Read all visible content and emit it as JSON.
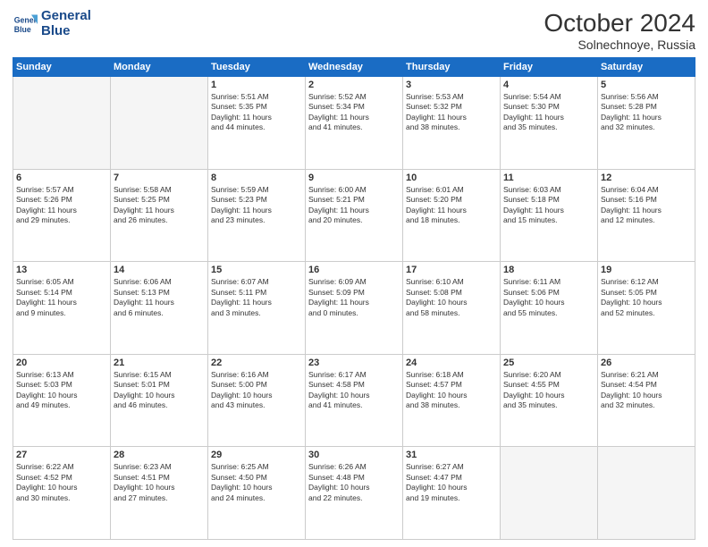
{
  "header": {
    "logo_line1": "General",
    "logo_line2": "Blue",
    "month_title": "October 2024",
    "subtitle": "Solnechnoye, Russia"
  },
  "weekdays": [
    "Sunday",
    "Monday",
    "Tuesday",
    "Wednesday",
    "Thursday",
    "Friday",
    "Saturday"
  ],
  "weeks": [
    [
      {
        "day": "",
        "text": ""
      },
      {
        "day": "",
        "text": ""
      },
      {
        "day": "1",
        "text": "Sunrise: 5:51 AM\nSunset: 5:35 PM\nDaylight: 11 hours\nand 44 minutes."
      },
      {
        "day": "2",
        "text": "Sunrise: 5:52 AM\nSunset: 5:34 PM\nDaylight: 11 hours\nand 41 minutes."
      },
      {
        "day": "3",
        "text": "Sunrise: 5:53 AM\nSunset: 5:32 PM\nDaylight: 11 hours\nand 38 minutes."
      },
      {
        "day": "4",
        "text": "Sunrise: 5:54 AM\nSunset: 5:30 PM\nDaylight: 11 hours\nand 35 minutes."
      },
      {
        "day": "5",
        "text": "Sunrise: 5:56 AM\nSunset: 5:28 PM\nDaylight: 11 hours\nand 32 minutes."
      }
    ],
    [
      {
        "day": "6",
        "text": "Sunrise: 5:57 AM\nSunset: 5:26 PM\nDaylight: 11 hours\nand 29 minutes."
      },
      {
        "day": "7",
        "text": "Sunrise: 5:58 AM\nSunset: 5:25 PM\nDaylight: 11 hours\nand 26 minutes."
      },
      {
        "day": "8",
        "text": "Sunrise: 5:59 AM\nSunset: 5:23 PM\nDaylight: 11 hours\nand 23 minutes."
      },
      {
        "day": "9",
        "text": "Sunrise: 6:00 AM\nSunset: 5:21 PM\nDaylight: 11 hours\nand 20 minutes."
      },
      {
        "day": "10",
        "text": "Sunrise: 6:01 AM\nSunset: 5:20 PM\nDaylight: 11 hours\nand 18 minutes."
      },
      {
        "day": "11",
        "text": "Sunrise: 6:03 AM\nSunset: 5:18 PM\nDaylight: 11 hours\nand 15 minutes."
      },
      {
        "day": "12",
        "text": "Sunrise: 6:04 AM\nSunset: 5:16 PM\nDaylight: 11 hours\nand 12 minutes."
      }
    ],
    [
      {
        "day": "13",
        "text": "Sunrise: 6:05 AM\nSunset: 5:14 PM\nDaylight: 11 hours\nand 9 minutes."
      },
      {
        "day": "14",
        "text": "Sunrise: 6:06 AM\nSunset: 5:13 PM\nDaylight: 11 hours\nand 6 minutes."
      },
      {
        "day": "15",
        "text": "Sunrise: 6:07 AM\nSunset: 5:11 PM\nDaylight: 11 hours\nand 3 minutes."
      },
      {
        "day": "16",
        "text": "Sunrise: 6:09 AM\nSunset: 5:09 PM\nDaylight: 11 hours\nand 0 minutes."
      },
      {
        "day": "17",
        "text": "Sunrise: 6:10 AM\nSunset: 5:08 PM\nDaylight: 10 hours\nand 58 minutes."
      },
      {
        "day": "18",
        "text": "Sunrise: 6:11 AM\nSunset: 5:06 PM\nDaylight: 10 hours\nand 55 minutes."
      },
      {
        "day": "19",
        "text": "Sunrise: 6:12 AM\nSunset: 5:05 PM\nDaylight: 10 hours\nand 52 minutes."
      }
    ],
    [
      {
        "day": "20",
        "text": "Sunrise: 6:13 AM\nSunset: 5:03 PM\nDaylight: 10 hours\nand 49 minutes."
      },
      {
        "day": "21",
        "text": "Sunrise: 6:15 AM\nSunset: 5:01 PM\nDaylight: 10 hours\nand 46 minutes."
      },
      {
        "day": "22",
        "text": "Sunrise: 6:16 AM\nSunset: 5:00 PM\nDaylight: 10 hours\nand 43 minutes."
      },
      {
        "day": "23",
        "text": "Sunrise: 6:17 AM\nSunset: 4:58 PM\nDaylight: 10 hours\nand 41 minutes."
      },
      {
        "day": "24",
        "text": "Sunrise: 6:18 AM\nSunset: 4:57 PM\nDaylight: 10 hours\nand 38 minutes."
      },
      {
        "day": "25",
        "text": "Sunrise: 6:20 AM\nSunset: 4:55 PM\nDaylight: 10 hours\nand 35 minutes."
      },
      {
        "day": "26",
        "text": "Sunrise: 6:21 AM\nSunset: 4:54 PM\nDaylight: 10 hours\nand 32 minutes."
      }
    ],
    [
      {
        "day": "27",
        "text": "Sunrise: 6:22 AM\nSunset: 4:52 PM\nDaylight: 10 hours\nand 30 minutes."
      },
      {
        "day": "28",
        "text": "Sunrise: 6:23 AM\nSunset: 4:51 PM\nDaylight: 10 hours\nand 27 minutes."
      },
      {
        "day": "29",
        "text": "Sunrise: 6:25 AM\nSunset: 4:50 PM\nDaylight: 10 hours\nand 24 minutes."
      },
      {
        "day": "30",
        "text": "Sunrise: 6:26 AM\nSunset: 4:48 PM\nDaylight: 10 hours\nand 22 minutes."
      },
      {
        "day": "31",
        "text": "Sunrise: 6:27 AM\nSunset: 4:47 PM\nDaylight: 10 hours\nand 19 minutes."
      },
      {
        "day": "",
        "text": ""
      },
      {
        "day": "",
        "text": ""
      }
    ]
  ]
}
